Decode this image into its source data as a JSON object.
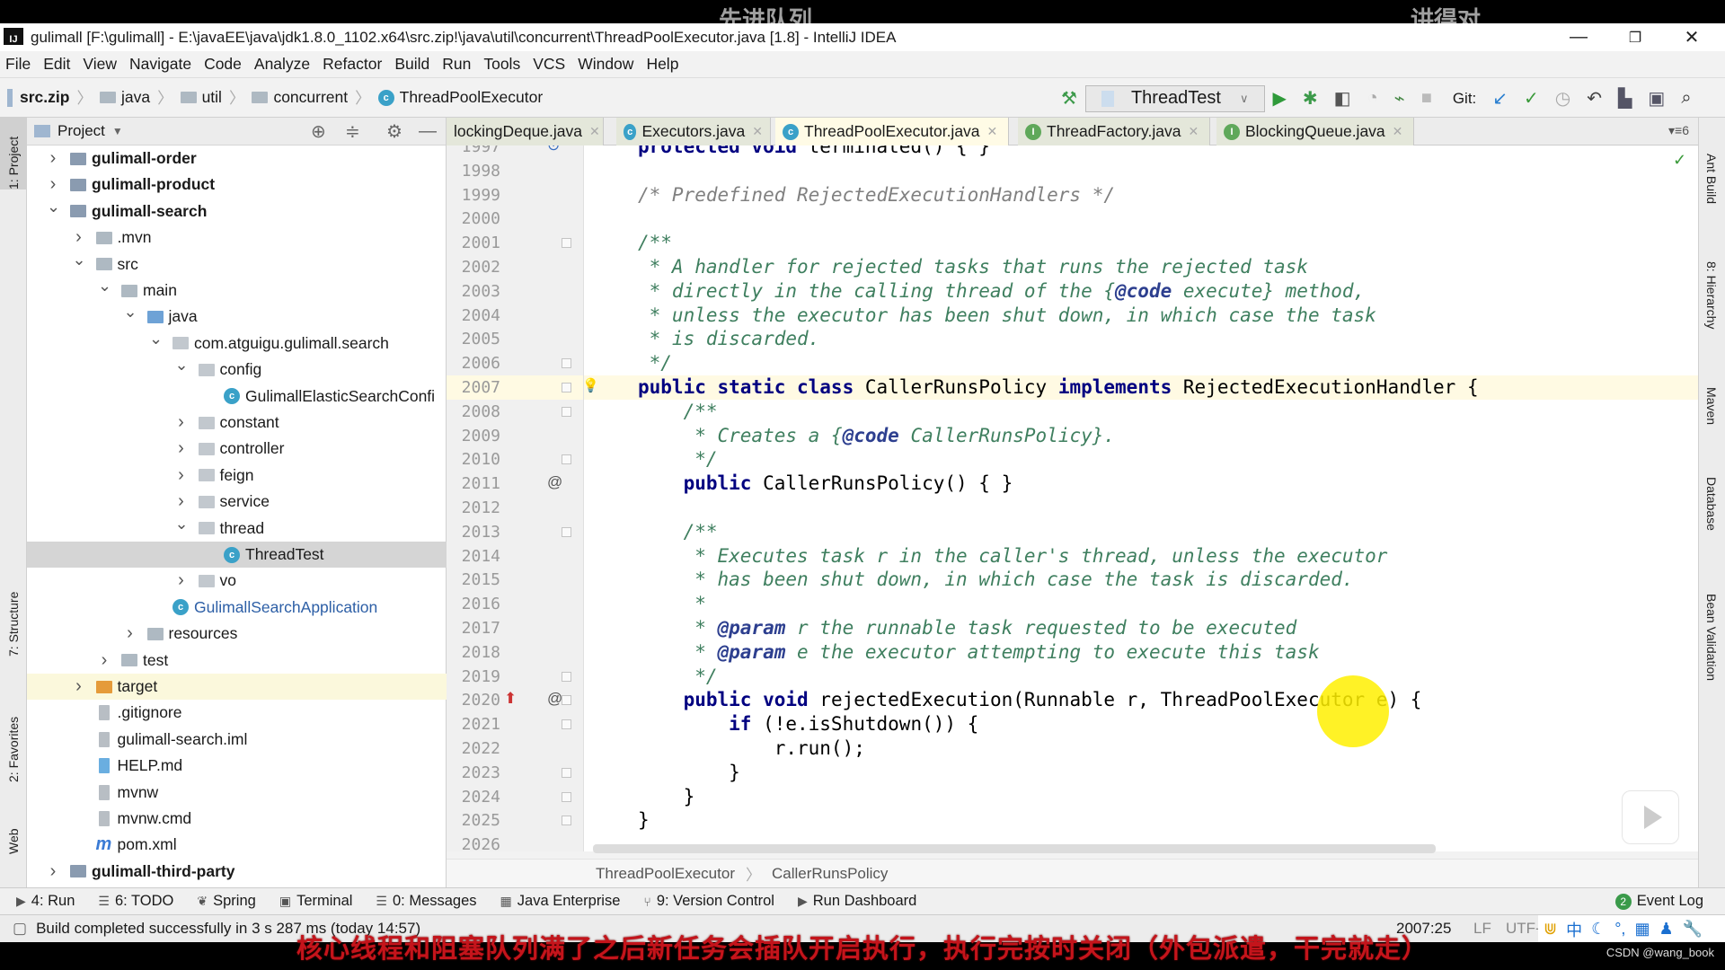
{
  "watermarks": [
    "先进队列",
    "讲得对"
  ],
  "window": {
    "title": "gulimall [F:\\gulimall] - E:\\javaEE\\java\\jdk1.8.0_1102.x64\\src.zip!\\java\\util\\concurrent\\ThreadPoolExecutor.java [1.8] - IntelliJ IDEA",
    "app_icon": "IJ",
    "minimize": "—",
    "restore": "❐",
    "close": "✕"
  },
  "menu": [
    "File",
    "Edit",
    "View",
    "Navigate",
    "Code",
    "Analyze",
    "Refactor",
    "Build",
    "Run",
    "Tools",
    "VCS",
    "Window",
    "Help"
  ],
  "breadcrumb": [
    "src.zip",
    "java",
    "util",
    "concurrent",
    "ThreadPoolExecutor"
  ],
  "toolbar": {
    "run_config": "ThreadTest",
    "git_label": "Git:",
    "icons": [
      "hammer-icon",
      "run-icon",
      "debug-icon",
      "coverage-icon",
      "profile-icon",
      "attach-icon",
      "stop-icon",
      "vcs-update-icon",
      "vcs-commit-icon",
      "history-icon",
      "revert-icon",
      "project-structure-icon",
      "terminal-icon",
      "search-icon"
    ]
  },
  "left_stripe": [
    "1: Project",
    "7: Structure",
    "2: Favorites",
    "Web"
  ],
  "right_stripe": [
    "Ant Build",
    "8: Hierarchy",
    "Maven",
    "Database",
    "Bean Validation"
  ],
  "project": {
    "header": "Project",
    "tree": [
      {
        "d": 0,
        "label": "gulimall-order",
        "type": "module",
        "state": "collapsed",
        "bold": true
      },
      {
        "d": 0,
        "label": "gulimall-product",
        "type": "module",
        "state": "collapsed",
        "bold": true
      },
      {
        "d": 0,
        "label": "gulimall-search",
        "type": "module",
        "state": "expanded",
        "bold": true
      },
      {
        "d": 1,
        "label": ".mvn",
        "type": "folder",
        "state": "collapsed"
      },
      {
        "d": 1,
        "label": "src",
        "type": "folder",
        "state": "expanded"
      },
      {
        "d": 2,
        "label": "main",
        "type": "folder",
        "state": "expanded"
      },
      {
        "d": 3,
        "label": "java",
        "type": "source",
        "state": "expanded"
      },
      {
        "d": 4,
        "label": "com.atguigu.gulimall.search",
        "type": "package",
        "state": "expanded"
      },
      {
        "d": 5,
        "label": "config",
        "type": "package",
        "state": "expanded"
      },
      {
        "d": 6,
        "label": "GulimallElasticSearchConfi",
        "type": "class"
      },
      {
        "d": 5,
        "label": "constant",
        "type": "package",
        "state": "collapsed"
      },
      {
        "d": 5,
        "label": "controller",
        "type": "package",
        "state": "collapsed"
      },
      {
        "d": 5,
        "label": "feign",
        "type": "package",
        "state": "collapsed"
      },
      {
        "d": 5,
        "label": "service",
        "type": "package",
        "state": "collapsed"
      },
      {
        "d": 5,
        "label": "thread",
        "type": "package",
        "state": "expanded"
      },
      {
        "d": 6,
        "label": "ThreadTest",
        "type": "class",
        "selected": true
      },
      {
        "d": 5,
        "label": "vo",
        "type": "package",
        "state": "collapsed"
      },
      {
        "d": 4,
        "label": "GulimallSearchApplication",
        "type": "app-class"
      },
      {
        "d": 3,
        "label": "resources",
        "type": "folder",
        "state": "collapsed"
      },
      {
        "d": 2,
        "label": "test",
        "type": "folder",
        "state": "collapsed"
      },
      {
        "d": 1,
        "label": "target",
        "type": "excluded-folder",
        "state": "collapsed",
        "highlight": true
      },
      {
        "d": 1,
        "label": ".gitignore",
        "type": "file"
      },
      {
        "d": 1,
        "label": "gulimall-search.iml",
        "type": "file"
      },
      {
        "d": 1,
        "label": "HELP.md",
        "type": "md"
      },
      {
        "d": 1,
        "label": "mvnw",
        "type": "file"
      },
      {
        "d": 1,
        "label": "mvnw.cmd",
        "type": "file"
      },
      {
        "d": 1,
        "label": "pom.xml",
        "type": "maven"
      },
      {
        "d": 0,
        "label": "gulimall-third-party",
        "type": "module",
        "state": "collapsed",
        "bold": true
      }
    ]
  },
  "tabs": [
    {
      "label": "lockingDeque.java",
      "kind": "class"
    },
    {
      "label": "Executors.java",
      "kind": "class"
    },
    {
      "label": "ThreadPoolExecutor.java",
      "kind": "class",
      "active": true
    },
    {
      "label": "ThreadFactory.java",
      "kind": "interface"
    },
    {
      "label": "BlockingQueue.java",
      "kind": "interface"
    }
  ],
  "tabs_overflow": "▾≡6",
  "editor": {
    "current_line": "2007",
    "lines": [
      {
        "n": "1997",
        "t": [
          [
            "kw",
            "protected void "
          ],
          [
            "pl",
            "terminated() { }"
          ]
        ]
      },
      {
        "n": "1998",
        "t": []
      },
      {
        "n": "1999",
        "t": [
          [
            "cm",
            "/* Predefined RejectedExecutionHandlers */"
          ]
        ]
      },
      {
        "n": "2000",
        "t": []
      },
      {
        "n": "2001",
        "t": [
          [
            "doc",
            "/**"
          ]
        ]
      },
      {
        "n": "2002",
        "t": [
          [
            "doc",
            " * A handler for rejected tasks that runs the rejected task"
          ]
        ]
      },
      {
        "n": "2003",
        "t": [
          [
            "doc",
            " * directly in the calling thread of the {"
          ],
          [
            "tag",
            "@code"
          ],
          [
            "doc",
            " execute} method,"
          ]
        ]
      },
      {
        "n": "2004",
        "t": [
          [
            "doc",
            " * unless the executor has been shut down, in which case the task"
          ]
        ]
      },
      {
        "n": "2005",
        "t": [
          [
            "doc",
            " * is discarded."
          ]
        ]
      },
      {
        "n": "2006",
        "t": [
          [
            "doc",
            " */"
          ]
        ]
      },
      {
        "n": "2007",
        "t": [
          [
            "kw",
            "public static class "
          ],
          [
            "pl",
            "CallerRunsPolicy "
          ],
          [
            "kw",
            "implements "
          ],
          [
            "pl",
            "RejectedExecutionHandler {"
          ]
        ]
      },
      {
        "n": "2008",
        "t": [
          [
            "doc",
            "    /**"
          ]
        ]
      },
      {
        "n": "2009",
        "t": [
          [
            "doc",
            "     * Creates a {"
          ],
          [
            "tag",
            "@code"
          ],
          [
            "doc",
            " CallerRunsPolicy}."
          ]
        ]
      },
      {
        "n": "2010",
        "t": [
          [
            "doc",
            "     */"
          ]
        ]
      },
      {
        "n": "2011",
        "t": [
          [
            "kw",
            "    public "
          ],
          [
            "pl",
            "CallerRunsPolicy() { }"
          ]
        ]
      },
      {
        "n": "2012",
        "t": []
      },
      {
        "n": "2013",
        "t": [
          [
            "doc",
            "    /**"
          ]
        ]
      },
      {
        "n": "2014",
        "t": [
          [
            "doc",
            "     * Executes task r in the caller's thread, unless the executor"
          ]
        ]
      },
      {
        "n": "2015",
        "t": [
          [
            "doc",
            "     * has been shut down, in which case the task is discarded."
          ]
        ]
      },
      {
        "n": "2016",
        "t": [
          [
            "doc",
            "     *"
          ]
        ]
      },
      {
        "n": "2017",
        "t": [
          [
            "doc",
            "     * "
          ],
          [
            "tag",
            "@param"
          ],
          [
            "doc",
            " r the runnable task requested to be executed"
          ]
        ]
      },
      {
        "n": "2018",
        "t": [
          [
            "doc",
            "     * "
          ],
          [
            "tag",
            "@param"
          ],
          [
            "doc",
            " e the executor attempting to execute this task"
          ]
        ]
      },
      {
        "n": "2019",
        "t": [
          [
            "doc",
            "     */"
          ]
        ]
      },
      {
        "n": "2020",
        "t": [
          [
            "kw",
            "    public void "
          ],
          [
            "pl",
            "rejectedExecution(Runnable r, ThreadPoolExecutor e) {"
          ]
        ]
      },
      {
        "n": "2021",
        "t": [
          [
            "kw",
            "        if "
          ],
          [
            "pl",
            "(!e.isShutdown()) {"
          ]
        ]
      },
      {
        "n": "2022",
        "t": [
          [
            "pl",
            "            r.run();"
          ]
        ]
      },
      {
        "n": "2023",
        "t": [
          [
            "pl",
            "        }"
          ]
        ]
      },
      {
        "n": "2024",
        "t": [
          [
            "pl",
            "    }"
          ]
        ]
      },
      {
        "n": "2025",
        "t": [
          [
            "pl",
            "}"
          ]
        ]
      },
      {
        "n": "2026",
        "t": []
      }
    ],
    "fold_lines": [
      "2001",
      "2006",
      "2007",
      "2008",
      "2010",
      "2013",
      "2019",
      "2020",
      "2021",
      "2023",
      "2024",
      "2025"
    ],
    "gutter_markers": [
      {
        "line": "1997",
        "icon": "overridden-method-icon",
        "glyph": "⊙"
      },
      {
        "line": "2007",
        "icon": "intention-bulb-icon",
        "glyph": "💡"
      },
      {
        "line": "2011",
        "icon": "annotation-icon",
        "glyph": "@"
      },
      {
        "line": "2020",
        "icon": "implements-method-icon",
        "glyph": "⬆"
      },
      {
        "line": "2020",
        "icon": "annotation-icon",
        "glyph": "@"
      }
    ],
    "breadcrumb": [
      "ThreadPoolExecutor",
      "CallerRunsPolicy"
    ]
  },
  "bottom_tools": [
    {
      "label": "4: Run",
      "icon": "▶"
    },
    {
      "label": "6: TODO",
      "icon": "☰"
    },
    {
      "label": "Spring",
      "icon": "❦"
    },
    {
      "label": "Terminal",
      "icon": "▣"
    },
    {
      "label": "0: Messages",
      "icon": "☰"
    },
    {
      "label": "Java Enterprise",
      "icon": "▦"
    },
    {
      "label": "9: Version Control",
      "icon": "⑂"
    },
    {
      "label": "Run Dashboard",
      "icon": "▶"
    }
  ],
  "event_log": {
    "label": "Event Log",
    "count": "2"
  },
  "status": {
    "message": "Build completed successfully in 3 s 287 ms (today 14:57)",
    "position": "2007:25",
    "line_sep": "LF",
    "encoding": "UTF-"
  },
  "subtitle": "核心线程和阻塞队列满了之后新任务会插队开启执行，执行完按时关闭（外包派遣，干完就走）",
  "credit": "CSDN @wang_book",
  "colors": {
    "keyword": "#000080",
    "doc_comment": "#3f7f5f",
    "comment": "#808080",
    "current_line": "#fffae3",
    "selection": "#d5d5d5",
    "subtitle": "#c4141b"
  }
}
